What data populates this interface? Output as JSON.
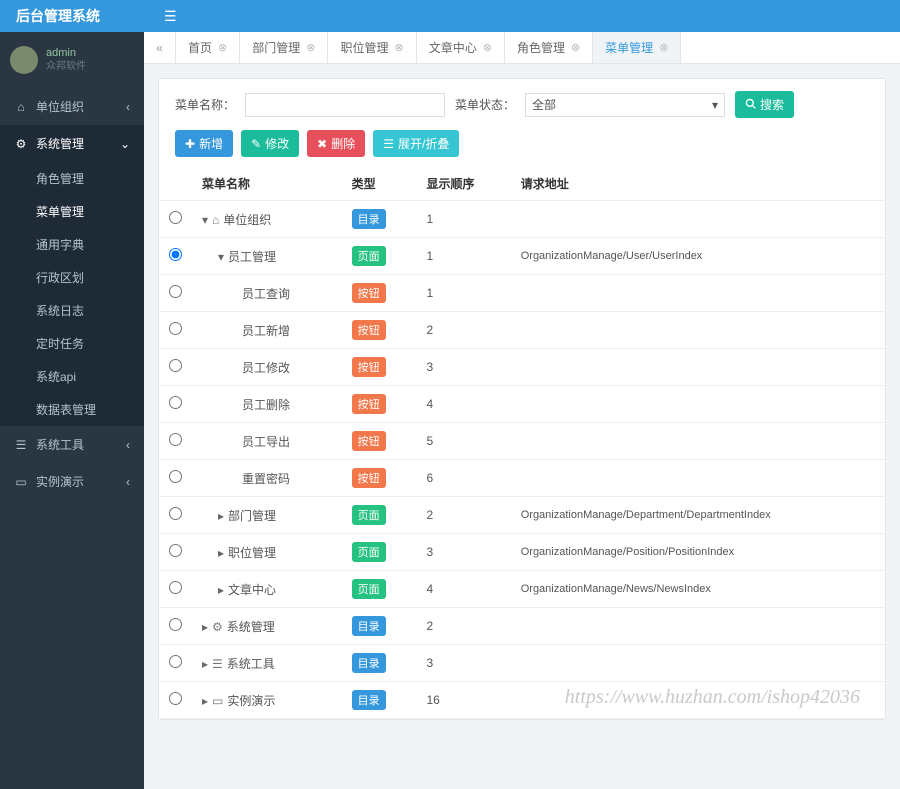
{
  "app_title": "后台管理系统",
  "user": {
    "name": "admin",
    "sub": "众邦软件"
  },
  "sidebar": {
    "items": [
      {
        "icon": "home",
        "label": "单位组织",
        "has_caret": true
      },
      {
        "icon": "gear",
        "label": "系统管理",
        "has_caret": true,
        "expanded": true,
        "submenu": [
          {
            "label": "角色管理"
          },
          {
            "label": "菜单管理",
            "active": true
          },
          {
            "label": "通用字典"
          },
          {
            "label": "行政区划"
          },
          {
            "label": "系统日志"
          },
          {
            "label": "定时任务"
          },
          {
            "label": "系统api"
          },
          {
            "label": "数据表管理"
          }
        ]
      },
      {
        "icon": "sliders",
        "label": "系统工具",
        "has_caret": true
      },
      {
        "icon": "tablet",
        "label": "实例演示",
        "has_caret": true
      }
    ]
  },
  "tabs": [
    {
      "label": "首页"
    },
    {
      "label": "部门管理"
    },
    {
      "label": "职位管理"
    },
    {
      "label": "文章中心"
    },
    {
      "label": "角色管理"
    },
    {
      "label": "菜单管理",
      "active": true
    }
  ],
  "search": {
    "name_label": "菜单名称：",
    "state_label": "菜单状态：",
    "state_value": "全部",
    "search_btn": "搜索"
  },
  "actions": {
    "add": "新增",
    "edit": "修改",
    "delete": "删除",
    "expand": "展开/折叠"
  },
  "table": {
    "headers": {
      "name": "菜单名称",
      "type": "类型",
      "order": "显示顺序",
      "url": "请求地址"
    },
    "type_labels": {
      "catalog": "目录",
      "page": "页面",
      "button": "按钮"
    },
    "rows": [
      {
        "indent": 0,
        "caret": "down",
        "icon": "home",
        "name": "单位组织",
        "type": "catalog",
        "order": "1",
        "url": ""
      },
      {
        "indent": 1,
        "caret": "down",
        "icon": "",
        "name": "员工管理",
        "type": "page",
        "order": "1",
        "url": "OrganizationManage/User/UserIndex",
        "selected": true
      },
      {
        "indent": 2,
        "caret": "",
        "icon": "",
        "name": "员工查询",
        "type": "button",
        "order": "1",
        "url": ""
      },
      {
        "indent": 2,
        "caret": "",
        "icon": "",
        "name": "员工新增",
        "type": "button",
        "order": "2",
        "url": ""
      },
      {
        "indent": 2,
        "caret": "",
        "icon": "",
        "name": "员工修改",
        "type": "button",
        "order": "3",
        "url": ""
      },
      {
        "indent": 2,
        "caret": "",
        "icon": "",
        "name": "员工删除",
        "type": "button",
        "order": "4",
        "url": ""
      },
      {
        "indent": 2,
        "caret": "",
        "icon": "",
        "name": "员工导出",
        "type": "button",
        "order": "5",
        "url": ""
      },
      {
        "indent": 2,
        "caret": "",
        "icon": "",
        "name": "重置密码",
        "type": "button",
        "order": "6",
        "url": ""
      },
      {
        "indent": 1,
        "caret": "right",
        "icon": "",
        "name": "部门管理",
        "type": "page",
        "order": "2",
        "url": "OrganizationManage/Department/DepartmentIndex"
      },
      {
        "indent": 1,
        "caret": "right",
        "icon": "",
        "name": "职位管理",
        "type": "page",
        "order": "3",
        "url": "OrganizationManage/Position/PositionIndex"
      },
      {
        "indent": 1,
        "caret": "right",
        "icon": "",
        "name": "文章中心",
        "type": "page",
        "order": "4",
        "url": "OrganizationManage/News/NewsIndex"
      },
      {
        "indent": 0,
        "caret": "right",
        "icon": "gear",
        "name": "系统管理",
        "type": "catalog",
        "order": "2",
        "url": ""
      },
      {
        "indent": 0,
        "caret": "right",
        "icon": "sliders",
        "name": "系统工具",
        "type": "catalog",
        "order": "3",
        "url": ""
      },
      {
        "indent": 0,
        "caret": "right",
        "icon": "tablet",
        "name": "实例演示",
        "type": "catalog",
        "order": "16",
        "url": ""
      }
    ]
  },
  "watermark": "https://www.huzhan.com/ishop42036"
}
